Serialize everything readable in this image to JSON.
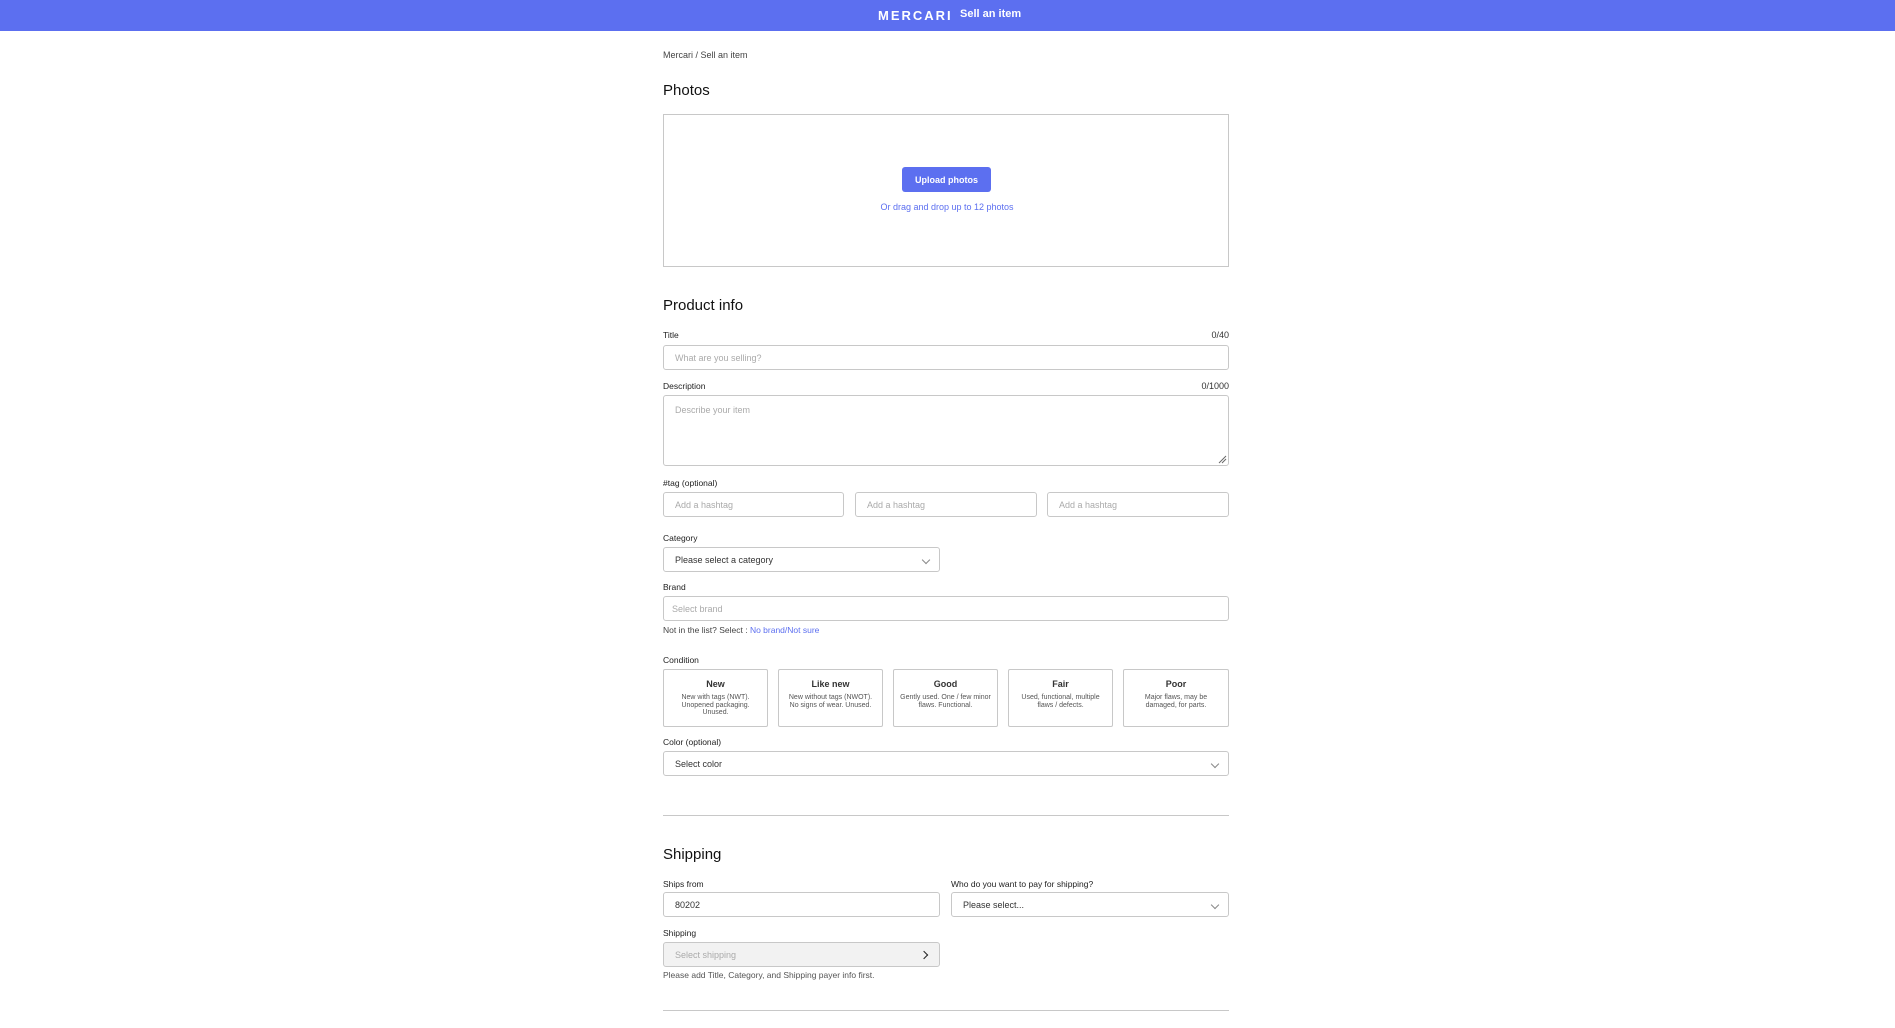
{
  "header": {
    "logo": "MERCARI",
    "title": "Sell an item"
  },
  "breadcrumb": "Mercari / Sell an item",
  "photos": {
    "heading": "Photos",
    "upload_button": "Upload photos",
    "hint": "Or drag and drop up to 12 photos"
  },
  "product_info": {
    "heading": "Product info",
    "title_label": "Title",
    "title_counter": "0/40",
    "title_placeholder": "What are you selling?",
    "description_label": "Description",
    "description_counter": "0/1000",
    "description_placeholder": "Describe your item",
    "hashtag_label": "#tag (optional)",
    "hashtag_placeholder": "Add a hashtag",
    "category_label": "Category",
    "category_value": "Please select a category",
    "brand_label": "Brand",
    "brand_placeholder": "Select brand",
    "brand_hint": "Not in the list? Select : ",
    "brand_link": "No brand/Not sure",
    "condition_label": "Condition",
    "conditions": [
      {
        "title": "New",
        "desc": "New with tags (NWT). Unopened packaging. Unused."
      },
      {
        "title": "Like new",
        "desc": "New without tags (NWOT). No signs of wear. Unused."
      },
      {
        "title": "Good",
        "desc": "Gently used. One / few minor flaws. Functional."
      },
      {
        "title": "Fair",
        "desc": "Used, functional, multiple flaws / defects."
      },
      {
        "title": "Poor",
        "desc": "Major flaws, may be damaged, for parts."
      }
    ],
    "color_label": "Color (optional)",
    "color_value": "Select color"
  },
  "shipping": {
    "heading": "Shipping",
    "ships_from_label": "Ships from",
    "ships_from_value": "80202",
    "payer_label": "Who do you want to pay for shipping?",
    "payer_value": "Please select...",
    "shipping_label": "Shipping",
    "shipping_placeholder": "Select shipping",
    "shipping_hint": "Please add Title, Category, and Shipping payer info first."
  },
  "colors": {
    "accent": "#5c6ff0",
    "border": "#c8c8c8"
  }
}
